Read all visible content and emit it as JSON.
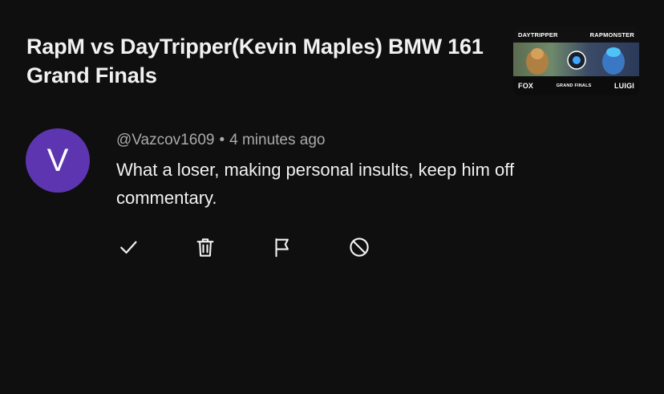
{
  "video": {
    "title": "RapM vs DayTripper(Kevin Maples) BMW 161 Grand Finals",
    "thumbnail": {
      "top_left": "DAYTRIPPER",
      "top_right": "RAPMONSTER",
      "bottom_left": "FOX",
      "bottom_center": "GRAND FINALS",
      "bottom_right": "LUIGI"
    }
  },
  "comment": {
    "avatar_letter": "V",
    "avatar_color": "#5e35b1",
    "author": "@Vazcov1609",
    "separator": "•",
    "time": "4 minutes ago",
    "text": "What a loser, making personal insults, keep him off commentary."
  },
  "actions": [
    {
      "icon": "check-icon"
    },
    {
      "icon": "trash-icon"
    },
    {
      "icon": "flag-icon"
    },
    {
      "icon": "block-icon"
    }
  ]
}
